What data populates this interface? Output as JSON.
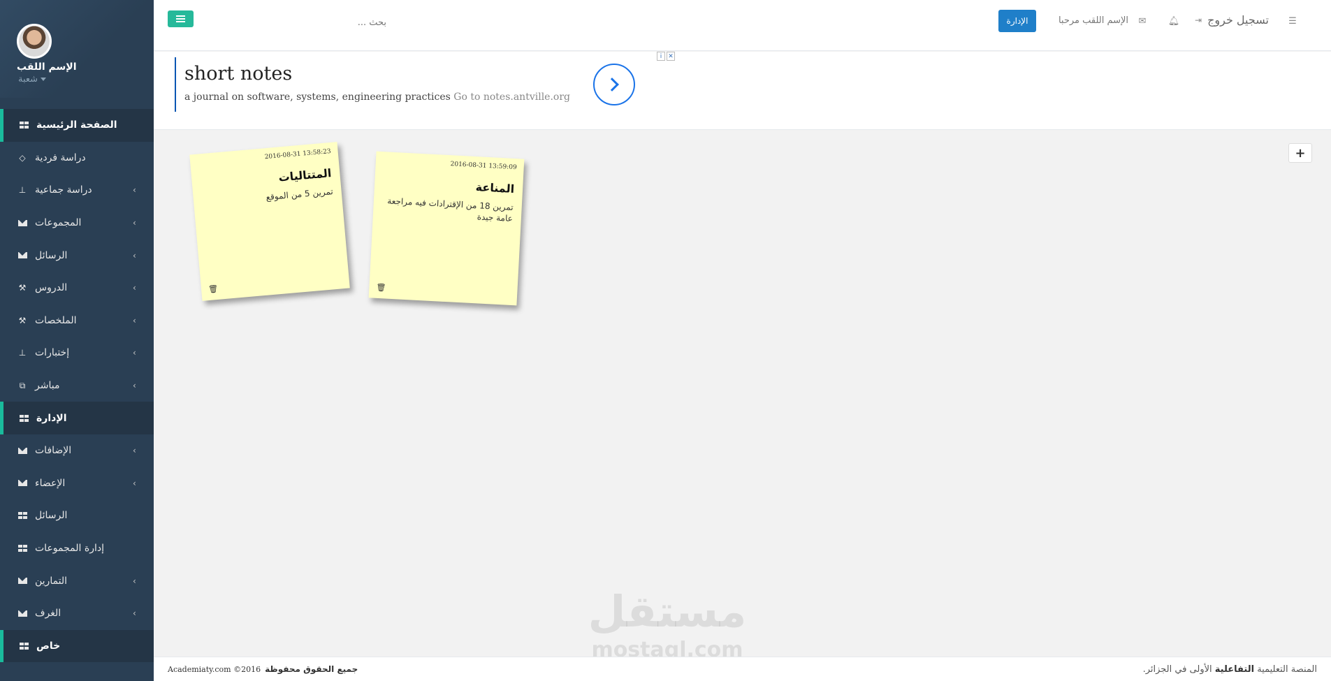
{
  "sidebar": {
    "profile": {
      "name": "الإسم اللقب",
      "role": "شعبة"
    },
    "items": [
      {
        "label": "الصفحة الرئيسية",
        "icon": "grid-icon",
        "active": true,
        "chevron": false
      },
      {
        "label": "دراسة فردية",
        "icon": "diamond-icon",
        "active": false,
        "chevron": false
      },
      {
        "label": "دراسة جماعية",
        "icon": "sitemap-icon",
        "active": false,
        "chevron": true
      },
      {
        "label": "المجموعات",
        "icon": "envelope-icon",
        "active": false,
        "chevron": true
      },
      {
        "label": "الرسائل",
        "icon": "envelope-icon",
        "active": false,
        "chevron": true
      },
      {
        "label": "الدروس",
        "icon": "wrench-icon",
        "active": false,
        "chevron": true
      },
      {
        "label": "الملخصات",
        "icon": "wrench-icon",
        "active": false,
        "chevron": true
      },
      {
        "label": "إختبارات",
        "icon": "sitemap-icon",
        "active": false,
        "chevron": true
      },
      {
        "label": "مباشر",
        "icon": "external-link-icon",
        "active": false,
        "chevron": true
      },
      {
        "label": "الإدارة",
        "icon": "grid-icon",
        "active": true,
        "chevron": false
      },
      {
        "label": "الإضافات",
        "icon": "envelope-icon",
        "active": false,
        "chevron": true
      },
      {
        "label": "الإعضاء",
        "icon": "envelope-icon",
        "active": false,
        "chevron": true
      },
      {
        "label": "الرسائل",
        "icon": "grid-icon",
        "active": false,
        "chevron": false
      },
      {
        "label": "إدارة المجموعات",
        "icon": "grid-icon",
        "active": false,
        "chevron": false
      },
      {
        "label": "التمارين",
        "icon": "envelope-icon",
        "active": false,
        "chevron": true
      },
      {
        "label": "الغرف",
        "icon": "envelope-icon",
        "active": false,
        "chevron": true
      },
      {
        "label": "خاص",
        "icon": "grid-icon",
        "active": true,
        "chevron": false
      }
    ]
  },
  "topbar": {
    "search_placeholder": "بحث ...",
    "admin_button": "الإدارة",
    "welcome": "الإسم اللقب مرحبا",
    "logout": "تسجيل خروج"
  },
  "ad": {
    "title": "short notes",
    "description": "a journal on software, systems, engineering practices",
    "link_text": "Go to notes.antville.org",
    "choices_info": "i",
    "choices_close": "✕"
  },
  "notes": [
    {
      "date": "2016-08-31 13:58:23",
      "title": "المتتاليات",
      "body": "تمرين 5 من الموقع"
    },
    {
      "date": "2016-08-31 13:59:09",
      "title": "المناعة",
      "body": "تمرين 18 من الإقترادات فيه مراجعة عامة جيدة"
    }
  ],
  "add_button": "+",
  "watermark": {
    "main": "مستقل",
    "sub": "mostaql.com"
  },
  "footer": {
    "rights": "جميع الحقوق محفوظة",
    "copyright": "Academiaty.com ©2016",
    "tagline_pre": "المنصة التعليمية",
    "tagline_bold": "التفاعلية",
    "tagline_post": "الأولى في الجزائر."
  },
  "colors": {
    "sidebar_bg": "#2a3f54",
    "accent_green": "#1abb9c",
    "button_blue": "#1f7fc9",
    "note_yellow": "#ffffc4"
  }
}
